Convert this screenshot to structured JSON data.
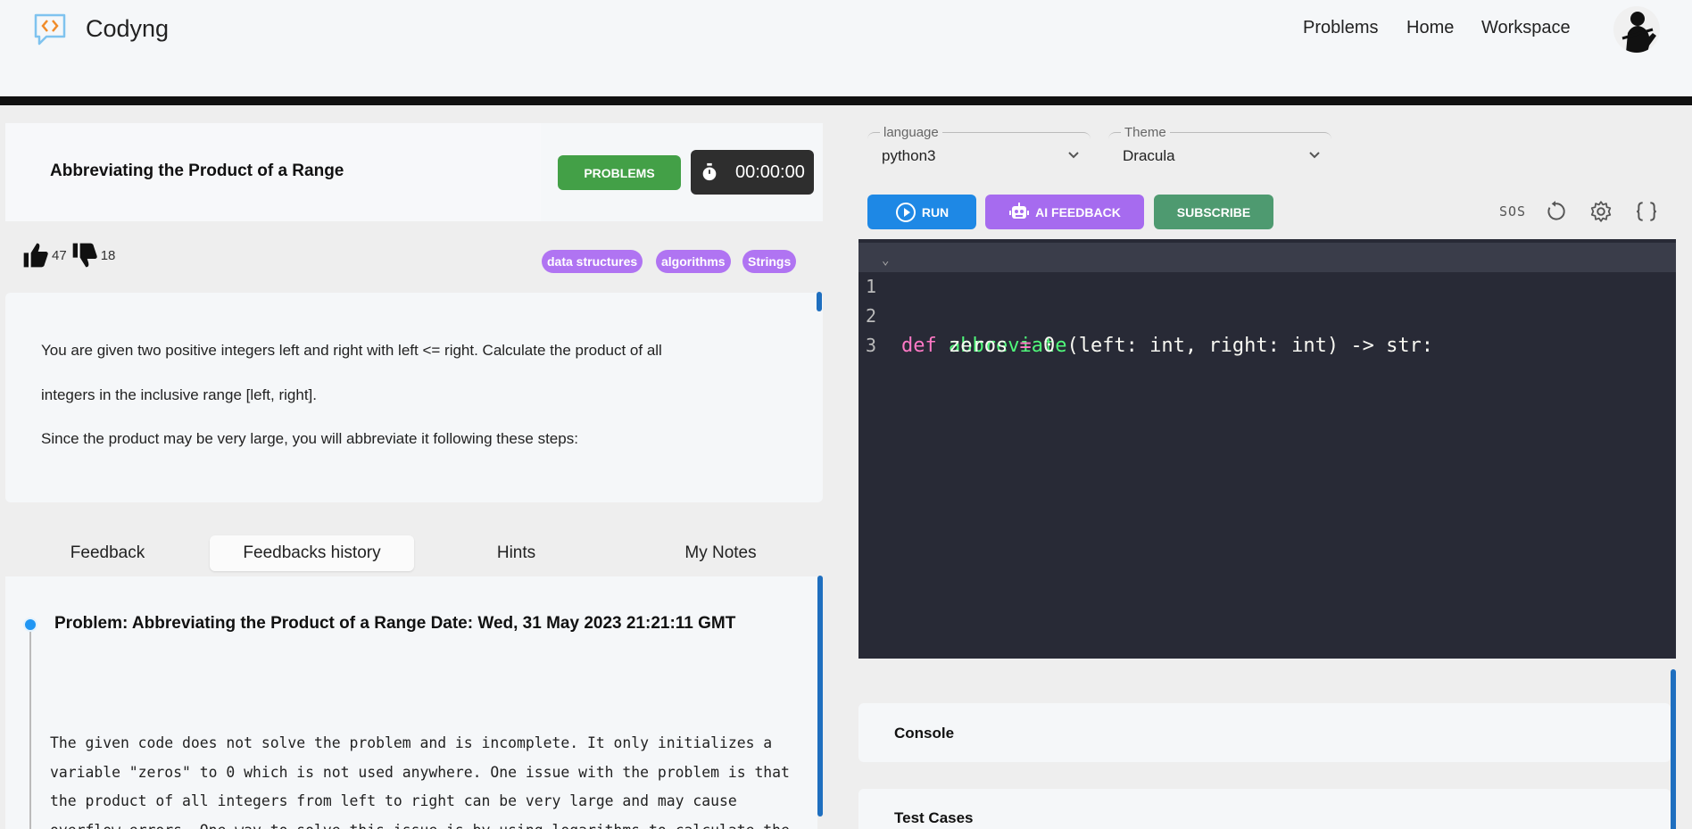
{
  "header": {
    "brand": "Codyng",
    "nav": [
      "Problems",
      "Home",
      "Workspace"
    ]
  },
  "problem": {
    "title": "Abbreviating the Product of a Range",
    "problems_button": "PROBLEMS",
    "timer": "00:00:00",
    "likes": "47",
    "dislikes": "18",
    "tags": [
      "data structures",
      "algorithms",
      "Strings"
    ],
    "description": [
      "You are given two positive integers left and right with left <= right. Calculate the product of all",
      "integers in the inclusive range [left, right].",
      "Since the product may be very large, you will abbreviate it following these steps:"
    ]
  },
  "tabs": [
    "Feedback",
    "Feedbacks history",
    "Hints",
    "My Notes"
  ],
  "active_tab": "Feedbacks history",
  "feedback": {
    "title": "Problem: Abbreviating the Product of a Range Date: Wed, 31 May 2023 21:21:11 GMT",
    "body": "The given code does not solve the problem and is incomplete. It only initializes a\nvariable \"zeros\" to 0 which is not used anywhere. One issue with the problem is that\nthe product of all integers from left to right can be very large and may cause\noverflow errors. One way to solve this issue is by using logarithms to calculate the"
  },
  "editor": {
    "language_label": "language",
    "language": "python3",
    "theme_label": "Theme",
    "theme": "Dracula",
    "run": "RUN",
    "ai_feedback": "AI FEEDBACK",
    "subscribe": "SUBSCRIBE",
    "sos": "SOS",
    "line_numbers": [
      "1",
      "2",
      "3"
    ]
  },
  "panels": {
    "console": "Console",
    "test_cases": "Test Cases"
  },
  "colors": {
    "problems_button": "#43a047",
    "run_button": "#1e88e5",
    "ai_button": "#a66bef",
    "subscribe_button": "#4e9a70",
    "tag": "#b074f2",
    "editor_bg": "#282a36"
  }
}
